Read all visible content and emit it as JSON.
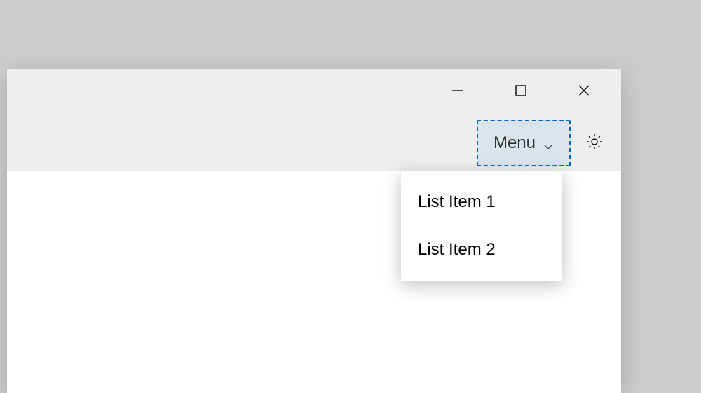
{
  "toolbar": {
    "menu_label": "Menu"
  },
  "dropdown": {
    "items": [
      {
        "label": "List Item 1"
      },
      {
        "label": "List Item 2"
      }
    ]
  }
}
